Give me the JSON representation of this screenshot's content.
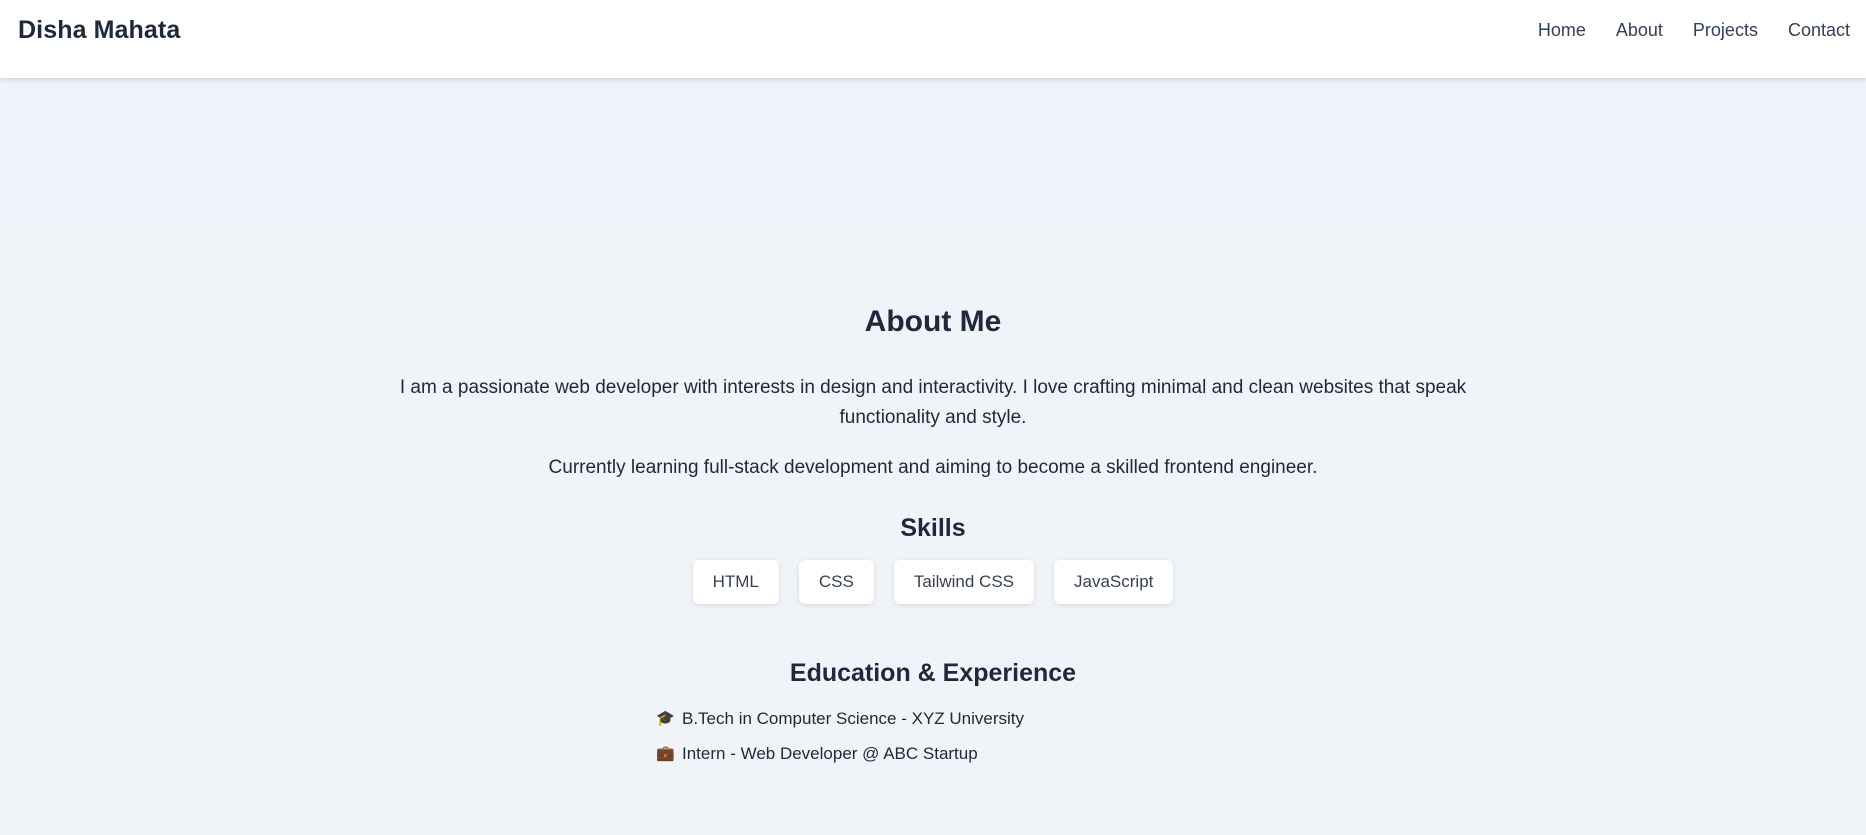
{
  "header": {
    "brand": "Disha Mahata",
    "nav": [
      "Home",
      "About",
      "Projects",
      "Contact"
    ]
  },
  "about": {
    "title": "About Me",
    "paragraph1": "I am a passionate web developer with interests in design and interactivity. I love crafting minimal and clean websites that speak functionality and style.",
    "paragraph2": "Currently learning full-stack development and aiming to become a skilled frontend engineer."
  },
  "skills": {
    "title": "Skills",
    "items": [
      "HTML",
      "CSS",
      "Tailwind CSS",
      "JavaScript"
    ]
  },
  "education": {
    "title": "Education & Experience",
    "items": [
      {
        "icon": "graduation-cap-icon",
        "text": "B.Tech in Computer Science - XYZ University"
      },
      {
        "icon": "briefcase-icon",
        "text": "Intern - Web Developer @ ABC Startup"
      }
    ]
  },
  "colors": {
    "hero_band": "#eef2fd",
    "section_bg": "#f0f3f8",
    "text_dark": "#1e293b"
  }
}
